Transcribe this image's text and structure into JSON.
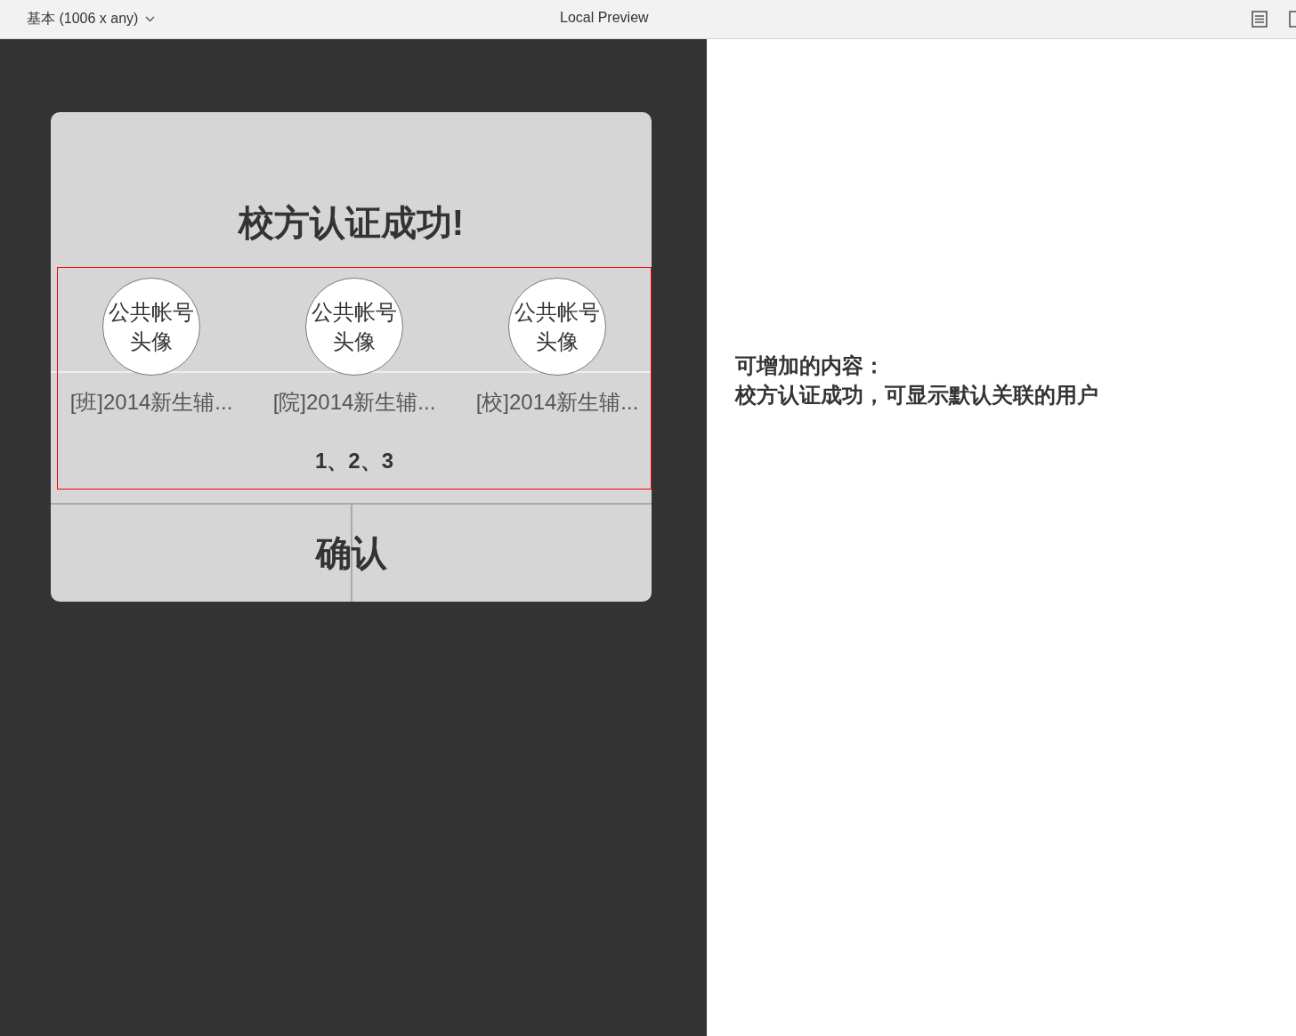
{
  "toolbar": {
    "device": "基本 (1006 x any)",
    "title": "Local Preview"
  },
  "dialog": {
    "title": "校方认证成功!",
    "accounts": [
      {
        "avatar": "公共帐号头像",
        "name": "[班]2014新生辅..."
      },
      {
        "avatar": "公共帐号头像",
        "name": "[院]2014新生辅..."
      },
      {
        "avatar": "公共帐号头像",
        "name": "[校]2014新生辅..."
      }
    ],
    "note": "1、2、3",
    "confirm": "确认"
  },
  "annotation": [
    "可增加的内容：",
    "校方认证成功，可显示默认关联的用户"
  ]
}
